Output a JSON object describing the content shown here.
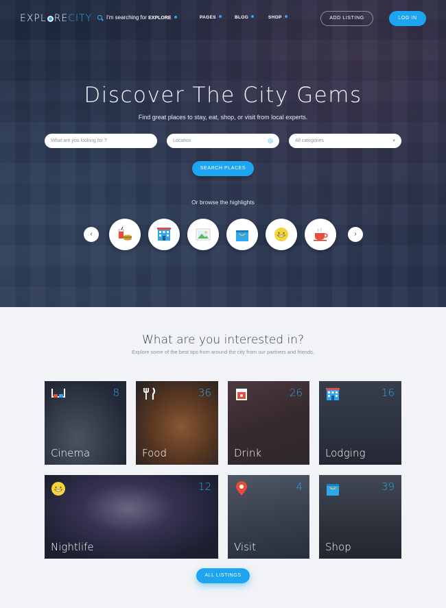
{
  "nav": {
    "logo_part1": "EXPL",
    "logo_part2": "RE",
    "logo_part3": "CITY",
    "search_text": "I'm searching for",
    "search_value": "EXPLORE",
    "links": [
      "PAGES",
      "BLOG",
      "SHOP"
    ],
    "add_listing": "ADD LISTING",
    "login": "LOG IN"
  },
  "hero": {
    "title": "Discover The City Gems",
    "subtitle": "Find great places to stay, eat, shop, or visit from local experts.",
    "keyword_placeholder": "What are you looking for ?",
    "location_placeholder": "Location",
    "category_value": "All categories",
    "search_button": "SEARCH PLACES",
    "browse_label": "Or browse the highlights",
    "highlights": [
      "food-icon",
      "hotel-icon",
      "picture-icon",
      "shopping-bag-icon",
      "smiley-icon",
      "coffee-cup-icon"
    ]
  },
  "interests": {
    "title": "What are you interested in?",
    "subtitle": "Explore some of the best tips from around the city from our partners and friends.",
    "categories": [
      {
        "name": "Cinema",
        "count": "8",
        "icon": "3d-glasses-icon"
      },
      {
        "name": "Food",
        "count": "36",
        "icon": "cutlery-icon"
      },
      {
        "name": "Drink",
        "count": "26",
        "icon": "drink-icon"
      },
      {
        "name": "Lodging",
        "count": "16",
        "icon": "building-icon"
      },
      {
        "name": "Nightlife",
        "count": "12",
        "icon": "smiley-icon"
      },
      {
        "name": "Visit",
        "count": "4",
        "icon": "map-pin-icon"
      },
      {
        "name": "Shop",
        "count": "39",
        "icon": "shopping-bag-icon"
      }
    ],
    "all_button": "ALL LISTINGS"
  },
  "colors": {
    "accent": "#1ea5f2",
    "hero_dark": "#222d44",
    "page_bg": "#f1f3f6"
  }
}
